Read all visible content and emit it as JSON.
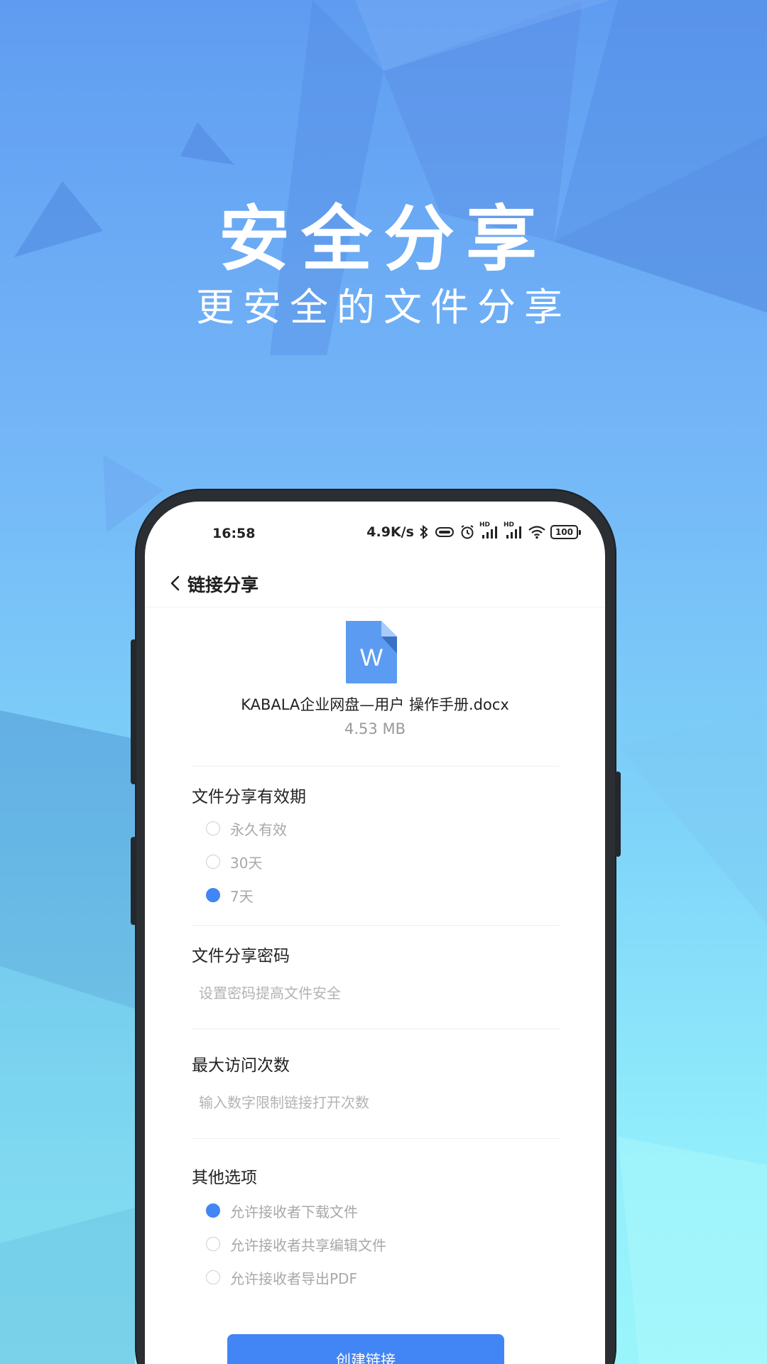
{
  "hero": {
    "title": "安全分享",
    "subtitle": "更安全的文件分享"
  },
  "status_bar": {
    "time": "16:58",
    "network_speed": "4.9K/s",
    "hd_label_1": "HD",
    "hd_label_2": "HD",
    "battery": "100",
    "icons": [
      "bluetooth-icon",
      "vibrate-icon",
      "alarm-icon",
      "signal-icon",
      "signal-icon",
      "wifi-icon",
      "battery-icon"
    ]
  },
  "nav": {
    "title": "链接分享"
  },
  "file": {
    "icon_letter": "W",
    "name": "KABALA企业网盘—用户 操作手册.docx",
    "size": "4.53 MB"
  },
  "validity": {
    "title": "文件分享有效期",
    "options": [
      {
        "label": "永久有效",
        "checked": false
      },
      {
        "label": "30天",
        "checked": false
      },
      {
        "label": "7天",
        "checked": true
      }
    ]
  },
  "password": {
    "title": "文件分享密码",
    "placeholder": "设置密码提高文件安全",
    "value": ""
  },
  "max_visits": {
    "title": "最大访问次数",
    "placeholder": "输入数字限制链接打开次数",
    "value": ""
  },
  "other": {
    "title": "其他选项",
    "options": [
      {
        "label": "允许接收者下载文件",
        "checked": true
      },
      {
        "label": "允许接收者共享编辑文件",
        "checked": false
      },
      {
        "label": "允许接收者导出PDF",
        "checked": false
      }
    ]
  },
  "actions": {
    "create_label": "创建链接"
  },
  "colors": {
    "accent": "#4285f4",
    "file_icon": "#5b9cf2"
  }
}
